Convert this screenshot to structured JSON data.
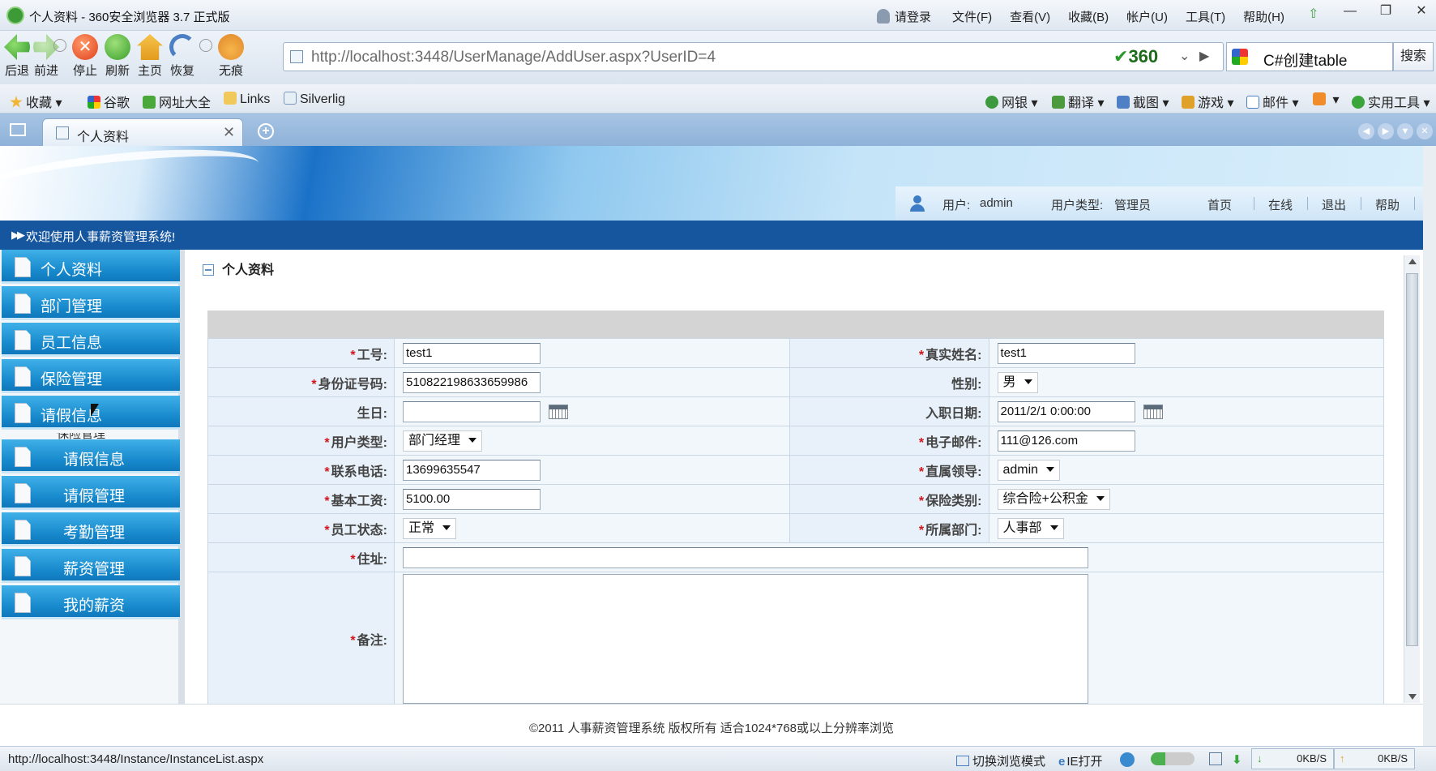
{
  "browser": {
    "window_title": "个人资料 - 360安全浏览器 3.7 正式版",
    "login": "请登录",
    "menus": [
      "文件(F)",
      "查看(V)",
      "收藏(B)",
      "帐户(U)",
      "工具(T)",
      "帮助(H)"
    ],
    "nav": [
      {
        "label": "后退",
        "icon": "back-arrow-icon"
      },
      {
        "label": "前进",
        "icon": "forward-arrow-icon"
      },
      {
        "label": "停止",
        "icon": "stop-icon"
      },
      {
        "label": "刷新",
        "icon": "refresh-icon"
      },
      {
        "label": "主页",
        "icon": "home-icon"
      },
      {
        "label": "恢复",
        "icon": "undo-icon"
      },
      {
        "label": "无痕",
        "icon": "paw-icon"
      }
    ],
    "url": "http://localhost:3448/UserManage/AddUser.aspx?UserID=4",
    "brand_badge": "360",
    "search_query": "C#创建table",
    "search_button": "搜索",
    "favorites": [
      "收藏",
      "谷歌",
      "网址大全",
      "Links",
      "Silverlig"
    ],
    "tools": [
      "网银",
      "翻译",
      "截图",
      "游戏",
      "邮件",
      "实用工具"
    ],
    "tab_title": "个人资料",
    "status_url": "http://localhost:3448/Instance/InstanceList.aspx",
    "status_items": [
      "切换浏览模式",
      "IE打开"
    ],
    "down_speed": "0KB/S",
    "up_speed": "0KB/S"
  },
  "site": {
    "user_label": "用户:",
    "user_name": "admin",
    "user_type_label": "用户类型:",
    "user_type": "管理员",
    "top_links": [
      "首页",
      "在线",
      "退出",
      "帮助"
    ],
    "welcome": "欢迎使用人事薪资管理系统!",
    "footer": "©2011 人事薪资管理系统  版权所有  适合1024*768或以上分辨率浏览"
  },
  "sidebar": {
    "top_items": [
      "个人资料",
      "部门管理",
      "员工信息",
      "保险管理",
      "请假信息"
    ],
    "submenu_caption": "保险管理",
    "sub_items": [
      "请假信息",
      "请假管理",
      "考勤管理",
      "薪资管理",
      "我的薪资"
    ]
  },
  "form": {
    "panel_title": "个人资料",
    "rows": [
      {
        "l_label": "工号:",
        "l_value": "test1",
        "r_label": "真实姓名:",
        "r_value": "test1"
      },
      {
        "l_label": "身份证号码:",
        "l_value": "510822198633659986",
        "r_label": "性别:",
        "r_value": "男"
      },
      {
        "l_label": "生日:",
        "l_value": "",
        "r_label": "入职日期:",
        "r_value": "2011/2/1 0:00:00"
      },
      {
        "l_label": "用户类型:",
        "l_value": "部门经理",
        "r_label": "电子邮件:",
        "r_value": "111@126.com"
      },
      {
        "l_label": "联系电话:",
        "l_value": "13699635547",
        "r_label": "直属领导:",
        "r_value": "admin"
      },
      {
        "l_label": "基本工资:",
        "l_value": "5100.00",
        "r_label": "保险类别:",
        "r_value": "综合险+公积金"
      },
      {
        "l_label": "员工状态:",
        "l_value": "正常",
        "r_label": "所属部门:",
        "r_value": "人事部"
      }
    ],
    "address_label": "住址:",
    "address_value": "",
    "remark_label": "备注:",
    "remark_value": ""
  },
  "colors": {
    "menu_blue": "#1688cb",
    "welcome_bar": "#16569f",
    "required_star": "#d4141c"
  }
}
